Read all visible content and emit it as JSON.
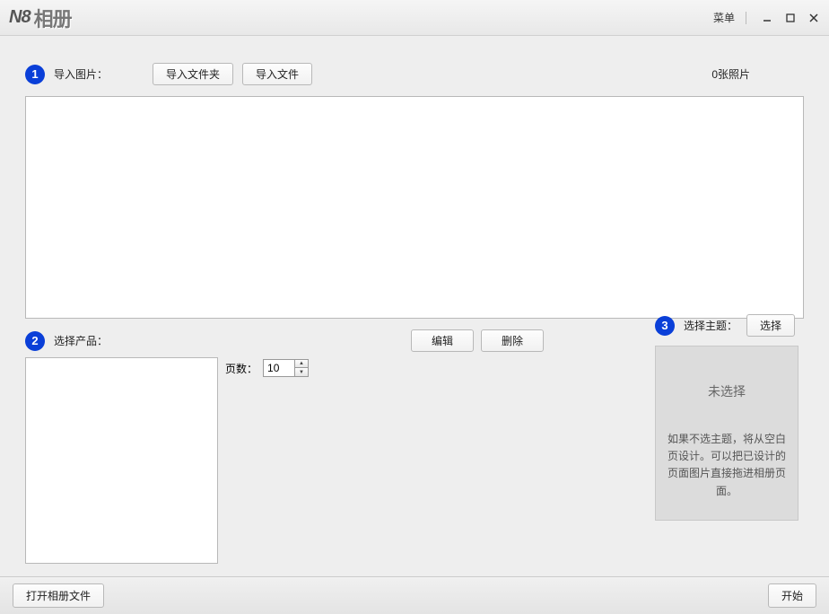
{
  "titlebar": {
    "logo_prefix": "N8",
    "logo_text": "相册",
    "menu_label": "菜单"
  },
  "step1": {
    "badge": "1",
    "label": "导入图片：",
    "import_folder_btn": "导入文件夹",
    "import_file_btn": "导入文件",
    "photo_count": "0张照片"
  },
  "step2": {
    "badge": "2",
    "label": "选择产品：",
    "edit_btn": "编辑",
    "delete_btn": "删除",
    "pages_label": "页数：",
    "pages_value": "10"
  },
  "step3": {
    "badge": "3",
    "label": "选择主题：",
    "select_btn": "选择",
    "status": "未选择",
    "help": "如果不选主题，将从空白页设计。可以把已设计的页面图片直接拖进相册页面。"
  },
  "footer": {
    "open_album_btn": "打开相册文件",
    "start_btn": "开始"
  }
}
